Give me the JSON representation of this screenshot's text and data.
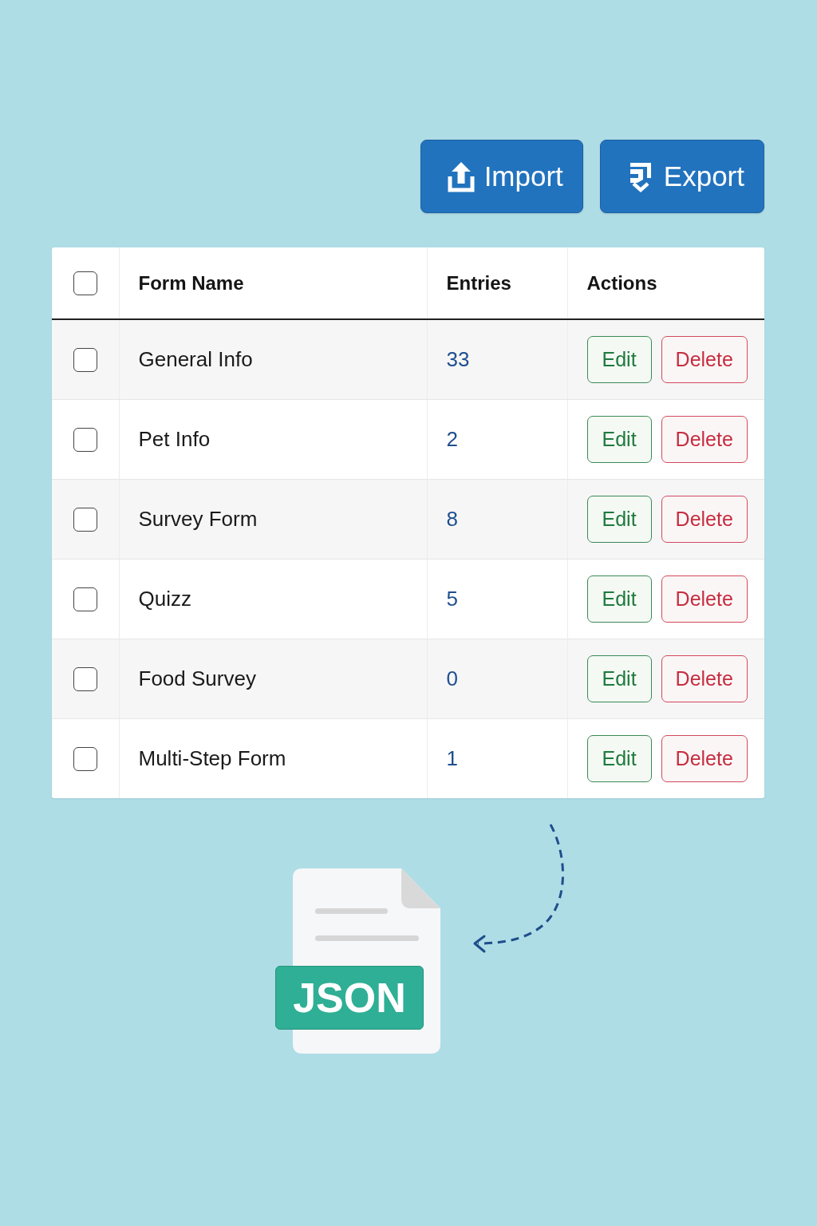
{
  "toolbar": {
    "buttons": [
      {
        "kind": "import",
        "label": "Import"
      },
      {
        "kind": "export",
        "label": "Export"
      }
    ]
  },
  "table": {
    "select_all": {
      "checked": false
    },
    "columns": [
      "Form Name",
      "Entries",
      "Actions"
    ],
    "rows": [
      {
        "checked": false,
        "name": "General Info",
        "entries": "33",
        "actions": [
          {
            "kind": "edit",
            "label": "Edit"
          },
          {
            "kind": "delete",
            "label": "Delete"
          }
        ]
      },
      {
        "checked": false,
        "name": "Pet Info",
        "entries": "2",
        "actions": [
          {
            "kind": "edit",
            "label": "Edit"
          },
          {
            "kind": "delete",
            "label": "Delete"
          }
        ]
      },
      {
        "checked": false,
        "name": "Survey Form",
        "entries": "8",
        "actions": [
          {
            "kind": "edit",
            "label": "Edit"
          },
          {
            "kind": "delete",
            "label": "Delete"
          }
        ]
      },
      {
        "checked": false,
        "name": "Quizz",
        "entries": "5",
        "actions": [
          {
            "kind": "edit",
            "label": "Edit"
          },
          {
            "kind": "delete",
            "label": "Delete"
          }
        ]
      },
      {
        "checked": false,
        "name": "Food Survey",
        "entries": "0",
        "actions": [
          {
            "kind": "edit",
            "label": "Edit"
          },
          {
            "kind": "delete",
            "label": "Delete"
          }
        ]
      },
      {
        "checked": false,
        "name": "Multi-Step Form",
        "entries": "1",
        "actions": [
          {
            "kind": "edit",
            "label": "Edit"
          },
          {
            "kind": "delete",
            "label": "Delete"
          }
        ]
      }
    ]
  },
  "illustration": {
    "file_label": "JSON"
  }
}
